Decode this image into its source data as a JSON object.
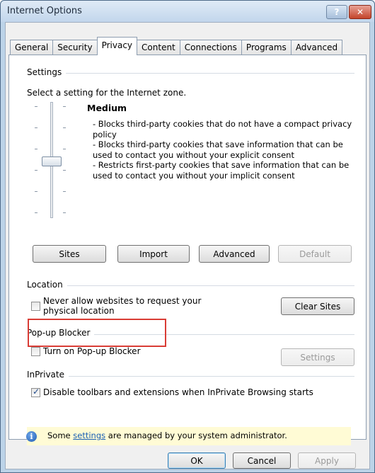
{
  "window": {
    "title": "Internet Options",
    "help_glyph": "?",
    "close_glyph": "✕"
  },
  "tabs": [
    {
      "label": "General"
    },
    {
      "label": "Security"
    },
    {
      "label": "Privacy",
      "active": true
    },
    {
      "label": "Content"
    },
    {
      "label": "Connections"
    },
    {
      "label": "Programs"
    },
    {
      "label": "Advanced"
    }
  ],
  "settings": {
    "group_label": "Settings",
    "intro": "Select a setting for the Internet zone.",
    "level": "Medium",
    "description": [
      "- Blocks third-party cookies that do not have a compact privacy policy",
      "- Blocks third-party cookies that save information that can be used to contact you without your explicit consent",
      "- Restricts first-party cookies that save information that can be used to contact you without your implicit consent"
    ],
    "buttons": {
      "sites": "Sites",
      "import": "Import",
      "advanced": "Advanced",
      "default": "Default"
    }
  },
  "location": {
    "group_label": "Location",
    "checkbox_label": "Never allow websites to request your physical location",
    "checkbox_checked": false,
    "clear_sites": "Clear Sites"
  },
  "popup_blocker": {
    "group_label": "Pop-up Blocker",
    "checkbox_label": "Turn on Pop-up Blocker",
    "checkbox_checked": false,
    "settings_button": "Settings"
  },
  "inprivate": {
    "group_label": "InPrivate",
    "checkbox_label": "Disable toolbars and extensions when InPrivate Browsing starts",
    "checkbox_checked": true
  },
  "notice": {
    "prefix": "Some ",
    "link": "settings",
    "suffix": " are managed by your system administrator.",
    "icon": "info-icon"
  },
  "footer": {
    "ok": "OK",
    "cancel": "Cancel",
    "apply": "Apply"
  },
  "colors": {
    "highlight_box": "#d93c35",
    "notice_bg": "#fffbd5",
    "link": "#1a5fb4"
  }
}
